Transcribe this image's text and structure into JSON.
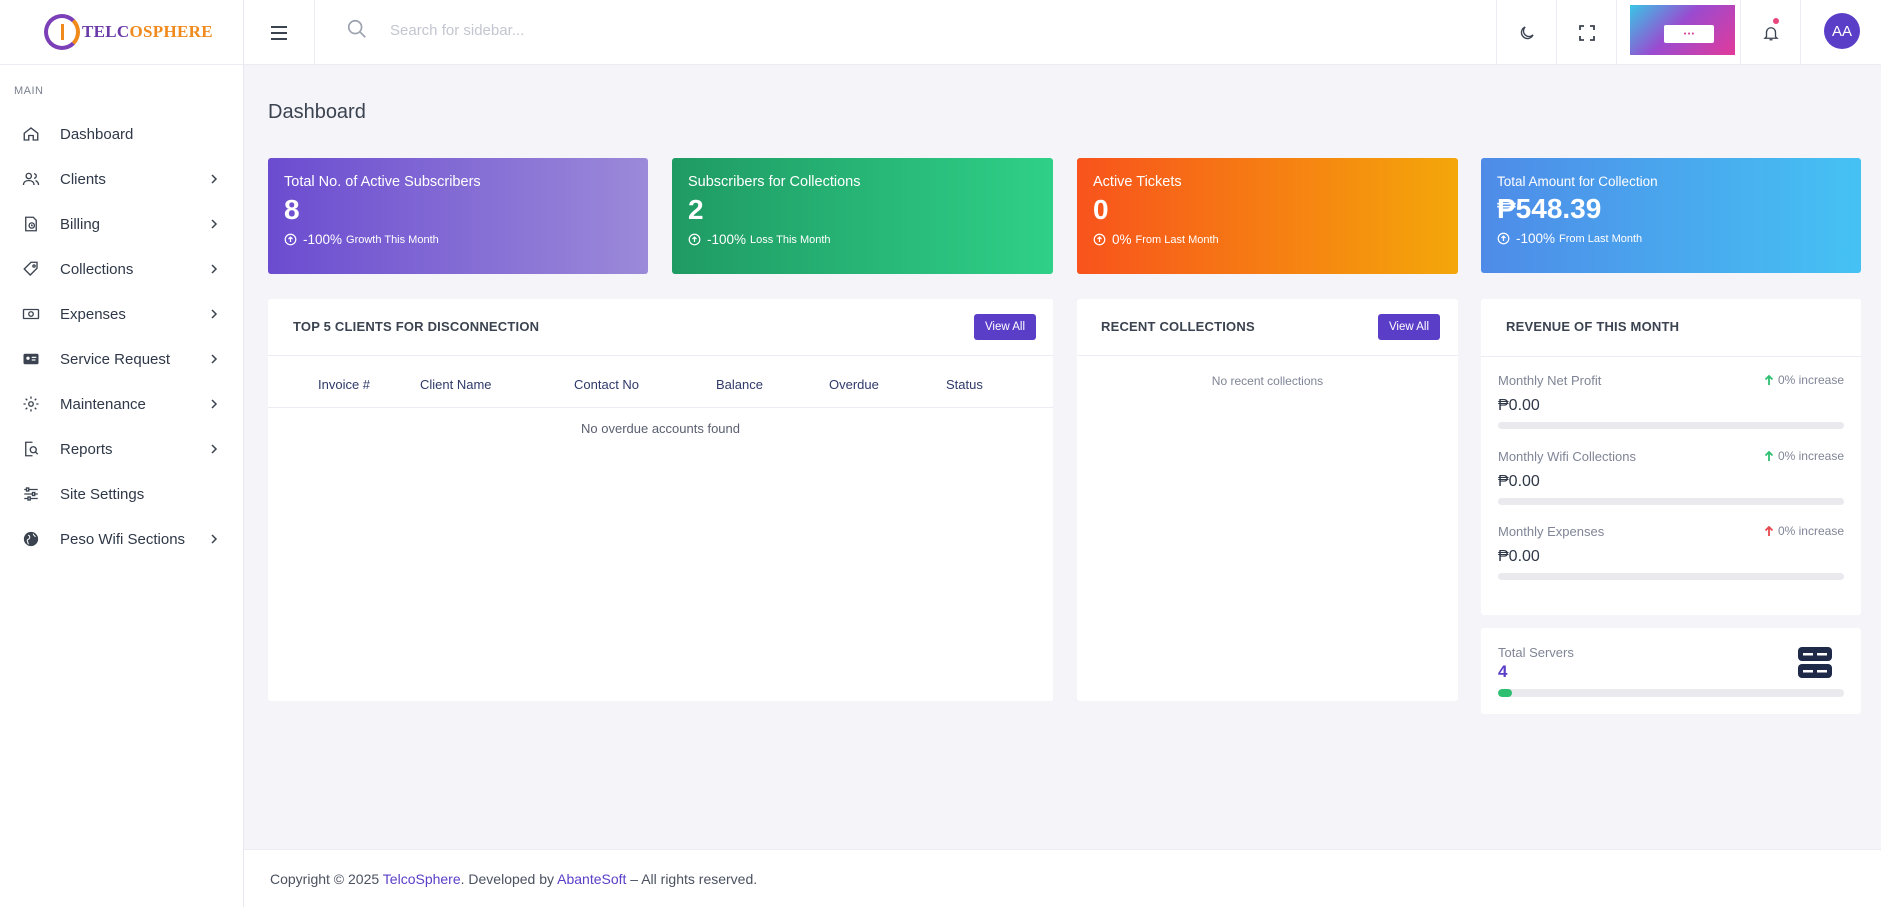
{
  "brand": {
    "name_prefix": "TELC",
    "name_o": "O",
    "name_suffix": "SPHERE",
    "colors": {
      "accent": "#5b3ec8",
      "orange": "#f08a1c"
    }
  },
  "sidebar": {
    "section": "MAIN",
    "items": [
      {
        "label": "Dashboard",
        "icon": "home-icon",
        "has_submenu": false
      },
      {
        "label": "Clients",
        "icon": "users-icon",
        "has_submenu": true
      },
      {
        "label": "Billing",
        "icon": "billing-icon",
        "has_submenu": true
      },
      {
        "label": "Collections",
        "icon": "tag-icon",
        "has_submenu": true
      },
      {
        "label": "Expenses",
        "icon": "money-icon",
        "has_submenu": true
      },
      {
        "label": "Service Request",
        "icon": "id-card-icon",
        "has_submenu": true
      },
      {
        "label": "Maintenance",
        "icon": "gear-icon",
        "has_submenu": true
      },
      {
        "label": "Reports",
        "icon": "report-search-icon",
        "has_submenu": true
      },
      {
        "label": "Site Settings",
        "icon": "sliders-icon",
        "has_submenu": false
      },
      {
        "label": "Peso Wifi Sections",
        "icon": "globe-icon",
        "has_submenu": true
      }
    ]
  },
  "header": {
    "search_placeholder": "Search for sidebar...",
    "avatar_initials": "AA",
    "icons": [
      "menu-icon",
      "search-icon",
      "moon-icon",
      "fullscreen-icon",
      "bell-icon"
    ]
  },
  "page": {
    "title": "Dashboard"
  },
  "stats": [
    {
      "label": "Total No. of Active Subscribers",
      "value": "8",
      "pct": "-100%",
      "note": "Growth This Month"
    },
    {
      "label": "Subscribers for Collections",
      "value": "2",
      "pct": "-100%",
      "note": "Loss This Month"
    },
    {
      "label": "Active Tickets",
      "value": "0",
      "pct": "0%",
      "note": "From Last Month"
    },
    {
      "label": "Total Amount for Collection",
      "value": "₱548.39",
      "pct": "-100%",
      "note": "From Last Month"
    }
  ],
  "disconnection": {
    "title": "TOP 5 CLIENTS FOR DISCONNECTION",
    "view_all": "View All",
    "columns": [
      "Invoice #",
      "Client Name",
      "Contact No",
      "Balance",
      "Overdue",
      "Status"
    ],
    "empty": "No overdue accounts found"
  },
  "recent": {
    "title": "RECENT COLLECTIONS",
    "view_all": "View All",
    "empty": "No recent collections"
  },
  "revenue": {
    "title": "REVENUE OF THIS MONTH",
    "rows": [
      {
        "label": "Monthly Net Profit",
        "increase": "0% increase",
        "value": "₱0.00",
        "arrow_color": "#2fbf71"
      },
      {
        "label": "Monthly Wifi Collections",
        "increase": "0% increase",
        "value": "₱0.00",
        "arrow_color": "#2fbf71"
      },
      {
        "label": "Monthly Expenses",
        "increase": "0% increase",
        "value": "₱0.00",
        "arrow_color": "#e5484d"
      }
    ]
  },
  "servers": {
    "label": "Total Servers",
    "value": "4",
    "progress_pct": 4
  },
  "footer": {
    "prefix": "Copyright © 2025 ",
    "brand": "TelcoSphere",
    "mid": ". Developed by ",
    "dev": "AbanteSoft",
    "suffix": " – All rights reserved."
  }
}
